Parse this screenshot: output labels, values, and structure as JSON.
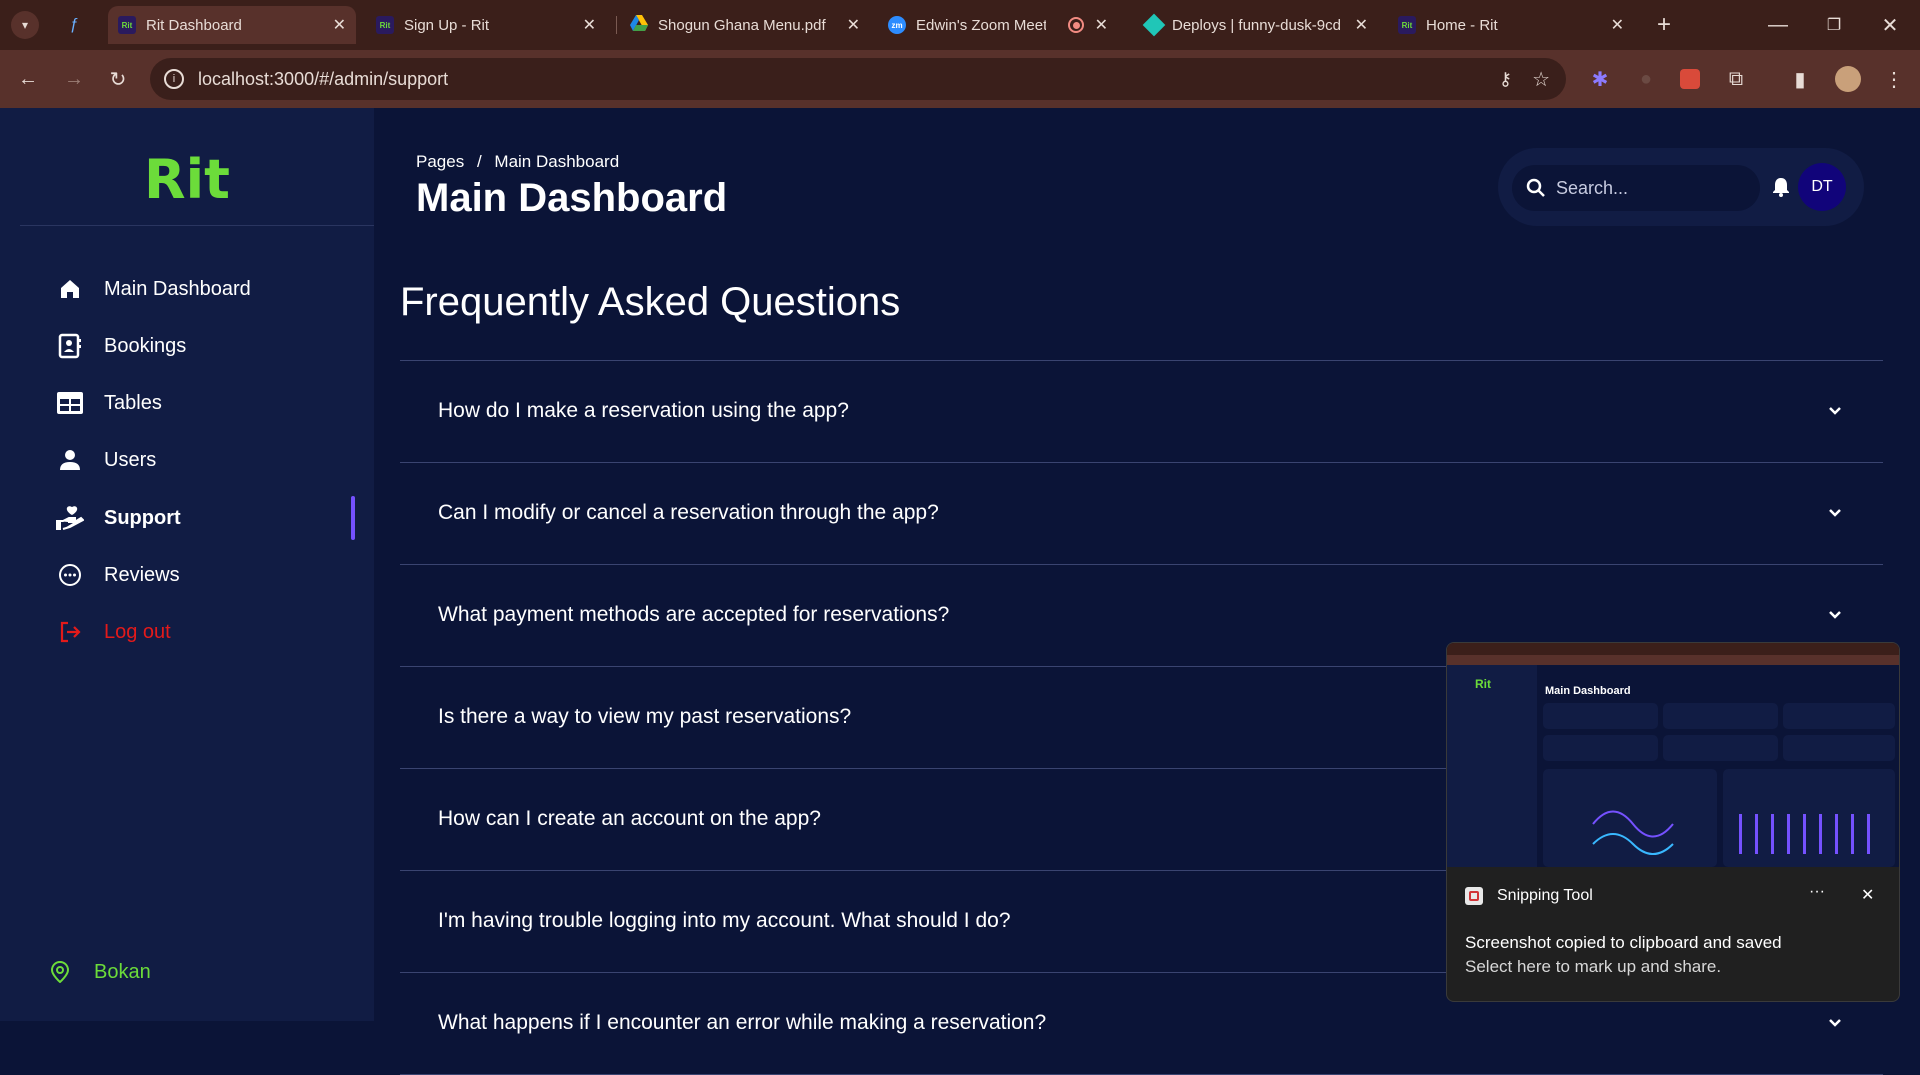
{
  "browser": {
    "tabs": [
      {
        "title": "",
        "favicon": "bolt-icon"
      },
      {
        "title": "Rit Dashboard",
        "favicon": "Rit",
        "active": true
      },
      {
        "title": "Sign Up - Rit",
        "favicon": "Rit"
      },
      {
        "title": "Shogun Ghana Menu.pdf",
        "favicon": "drive-icon"
      },
      {
        "title": "Edwin's Zoom Meetin",
        "favicon": "zm"
      },
      {
        "title": "Deploys | funny-dusk-9cd",
        "favicon": "netlify-icon"
      },
      {
        "title": "Home - Rit",
        "favicon": "Rit"
      }
    ],
    "url": "localhost:3000/#/admin/support"
  },
  "app": {
    "logo": "Rit",
    "nav": [
      {
        "label": "Main Dashboard",
        "icon": "home-icon"
      },
      {
        "label": "Bookings",
        "icon": "contact-card-icon"
      },
      {
        "label": "Tables",
        "icon": "table-icon"
      },
      {
        "label": "Users",
        "icon": "person-icon"
      },
      {
        "label": "Support",
        "icon": "hand-heart-icon",
        "active": true
      },
      {
        "label": "Reviews",
        "icon": "chat-bubble-icon"
      },
      {
        "label": "Log out",
        "icon": "logout-icon",
        "color": "#e31a1a"
      }
    ],
    "location": "Bokan",
    "accent": "#7551ff",
    "brand": "#6cdc3a"
  },
  "header": {
    "breadcrumb_root": "Pages",
    "breadcrumb_sep": "/",
    "breadcrumb_current": "Main Dashboard",
    "title": "Main Dashboard",
    "search_placeholder": "Search...",
    "avatar_initials": "DT"
  },
  "faq": {
    "heading": "Frequently Asked Questions",
    "questions": [
      "How do I make a reservation using the app?",
      "Can I modify or cancel a reservation through the app?",
      "What payment methods are accepted for reservations?",
      "Is there a way to view my past reservations?",
      "How can I create an account on the app?",
      "I'm having trouble logging into my account. What should I do?",
      "What happens if I encounter an error while making a reservation?"
    ]
  },
  "toast": {
    "app": "Snipping Tool",
    "message": "Screenshot copied to clipboard and saved",
    "sub": "Select here to mark up and share.",
    "more": "···"
  }
}
